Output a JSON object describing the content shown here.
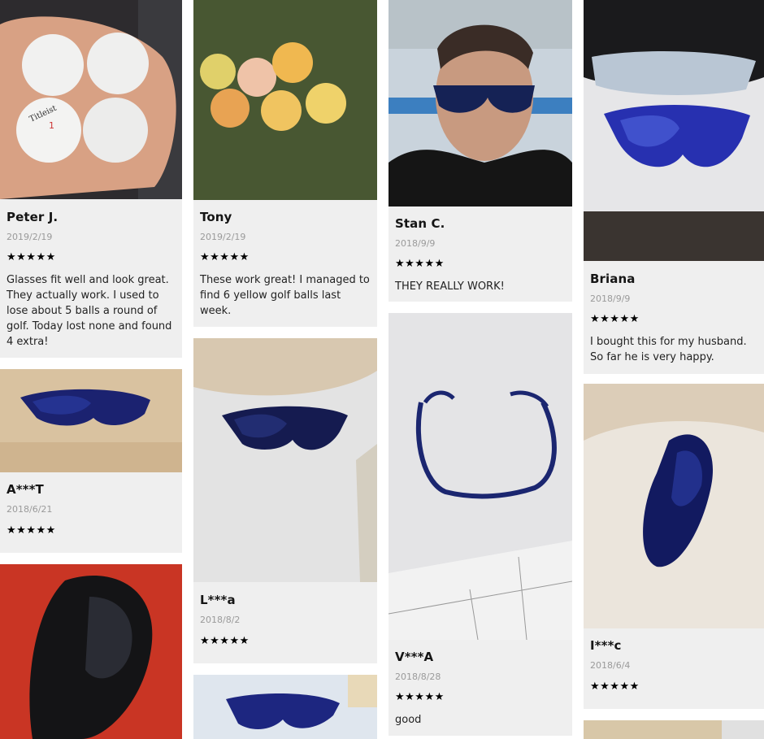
{
  "rating_stars": "★★★★★",
  "reviews": [
    {
      "author": "Peter J.",
      "date": "2019/2/19",
      "text": "Glasses fit well and look great. They actually work. I used to lose about 5 balls a round of golf. Today lost none and found 4 extra!"
    },
    {
      "author": "A***T",
      "date": "2018/6/21"
    },
    {
      "author": "Tony",
      "date": "2019/2/19",
      "text": "These work great! I managed to find 6 yellow golf balls last week."
    },
    {
      "author": "L***a",
      "date": "2018/8/2"
    },
    {
      "author": "Stan C.",
      "date": "2018/9/9",
      "text": "THEY REALLY WORK!"
    },
    {
      "author": "V***A",
      "date": "2018/8/28",
      "text": "good"
    },
    {
      "author": "Briana",
      "date": "2018/9/9",
      "text": "I bought this for my husband. So far he is very happy."
    },
    {
      "author": "I***c",
      "date": "2018/6/4"
    }
  ]
}
